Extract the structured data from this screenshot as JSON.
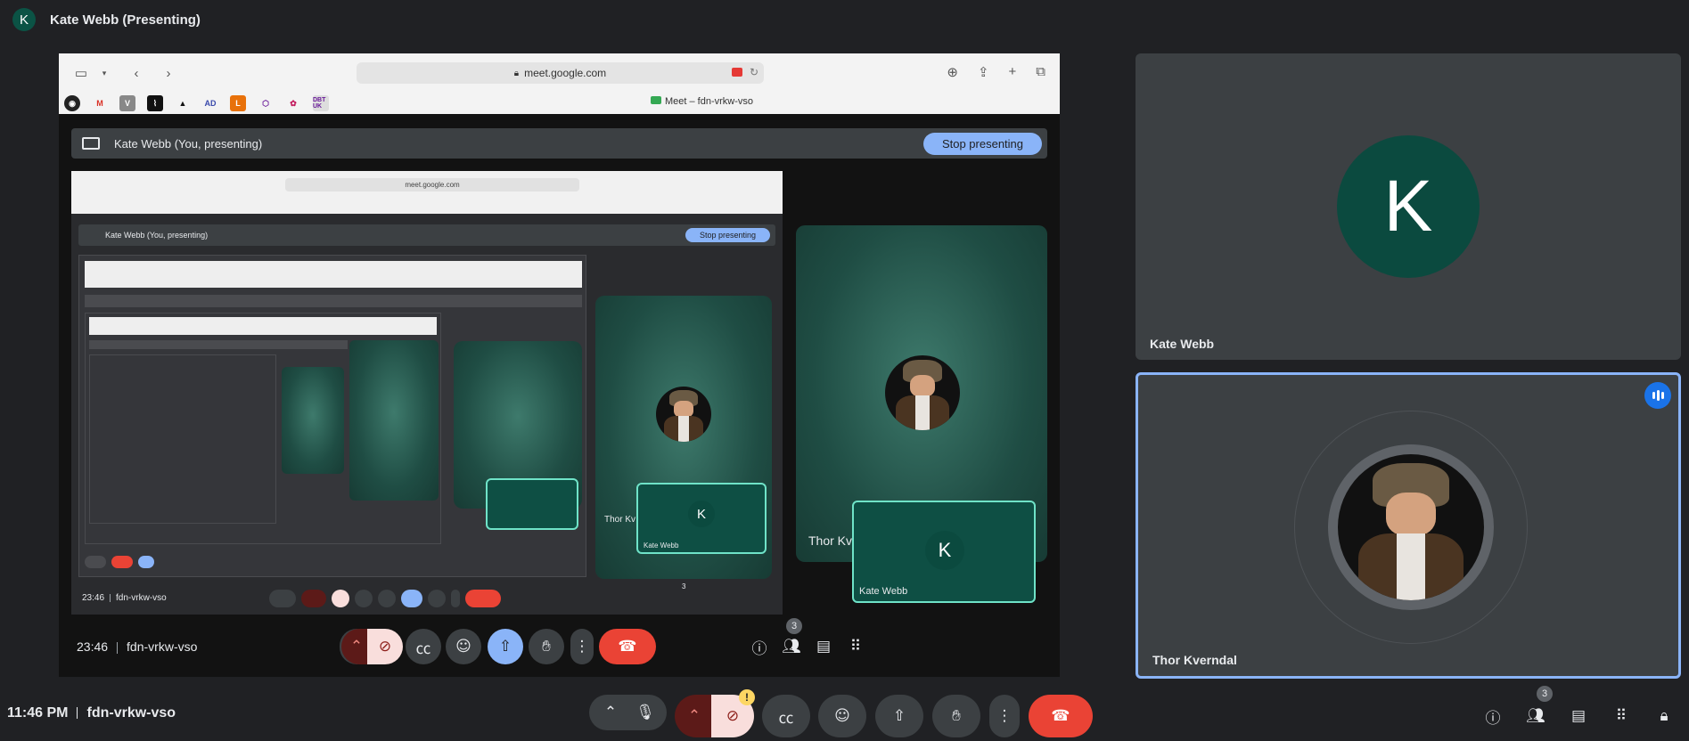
{
  "topbar": {
    "avatar_letter": "K",
    "title": "Kate Webb (Presenting)"
  },
  "shared_screen": {
    "browser": {
      "url": "meet.google.com",
      "tab_title": "Meet – fdn-vrkw-vso",
      "bookmarks": [
        "M",
        "V",
        "AD",
        "L",
        "DBT UK"
      ]
    },
    "presenting_bar": {
      "text": "Kate Webb (You, presenting)",
      "stop_label": "Stop presenting"
    },
    "recursive_view": {
      "url": "meet.google.com",
      "presenting_text": "Kate Webb (You, presenting)",
      "stop_label": "Stop presenting",
      "bottom_time": "23:46",
      "bottom_code": "fdn-vrkw-vso",
      "k_label": "K",
      "k_name": "Kate Webb",
      "thor_partial": "Thor Kv",
      "participants_badge": "3"
    },
    "large_tile": {
      "thor_partial": "Thor Kv",
      "k_label": "K",
      "k_name": "Kate Webb"
    },
    "bottom": {
      "time": "23:46",
      "code": "fdn-vrkw-vso",
      "participants_badge": "3"
    }
  },
  "side_tiles": {
    "kate": {
      "letter": "K",
      "name": "Kate Webb"
    },
    "thor": {
      "name": "Thor Kverndal"
    }
  },
  "footer": {
    "time": "11:46 PM",
    "code": "fdn-vrkw-vso",
    "participants_badge": "3",
    "warning_mark": "!"
  },
  "icons": {
    "more": "more-horiz-icon",
    "mic": "mic-icon",
    "camera_off": "camera-off-icon",
    "captions": "captions-icon",
    "emoji": "emoji-icon",
    "present": "present-icon",
    "hand": "raise-hand-icon",
    "end_call": "end-call-icon",
    "info": "info-icon",
    "people": "people-icon",
    "chat": "chat-icon",
    "apps": "apps-icon",
    "lock": "host-controls-icon"
  },
  "colors": {
    "background": "#202124",
    "end_call": "#ea4335",
    "present_active": "#8ab4f8",
    "avatar": "#0b4a3f",
    "speaking": "#1a73e8"
  }
}
